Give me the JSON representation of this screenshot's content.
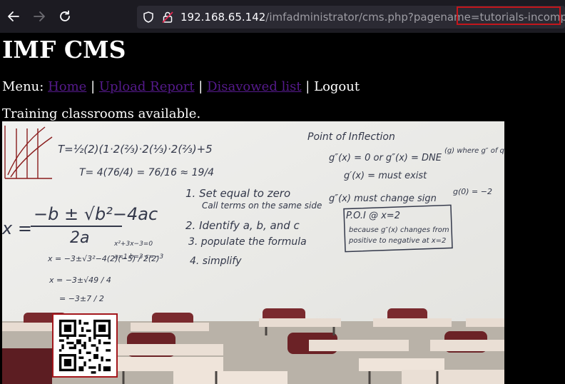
{
  "browser": {
    "url_host": "192.168.65.142",
    "url_path": "/imfadministrator/cms.php?pagename=",
    "url_query_highlight": "tutorials-incomplete"
  },
  "page": {
    "title": "IMF CMS",
    "menu_label": "Menu:",
    "menu_items": [
      {
        "label": "Home"
      },
      {
        "label": "Upload Report"
      },
      {
        "label": "Disavowed list"
      },
      {
        "label": "Logout"
      }
    ],
    "separator": "|",
    "intro": "Training classrooms available."
  },
  "whiteboard": {
    "formulas": {
      "t_eq_1": "T=½(2)(1·2(⅔)·2(⅓)·2(⅔)+5",
      "t_eq_2": "T= 4(76/4) = 76/16 ≈ 19/4",
      "quadratic_num": "−b ± √b²−4ac",
      "quadratic_den": "2a",
      "steps_1": "1. Set equal to zero",
      "steps_1b": "Call terms on the same side",
      "steps_2": "2. Identify a, b, and c",
      "steps_3": "3. populate the formula",
      "steps_4": "4. simplify",
      "poi_title": "Point of Inflection",
      "poi_1": "g″(x) = 0   or   g″(x) = DNE",
      "poi_2": "g′(x) = must exist",
      "poi_3": "g″(x) must change sign",
      "poi_box_1": "P.O.I @ x=2",
      "poi_box_2": "because g″(x) changes from",
      "poi_box_3": "positive to negative at x=2",
      "right_1": "(g) where g″ of ques",
      "right_2": "g(0) = −2",
      "x_eq_1": "x = −3±√3²−4(2)(−5) / 2(2)",
      "x_eq_2": "x = −3±√49 / 4",
      "x_eq_3": "= −3±7 / 2",
      "abc": "a=1 b=3 c=−3",
      "small_eq": "x²+3x−3=0"
    }
  },
  "colors": {
    "background": "#000000",
    "link_visited": "#551a8b",
    "highlight": "#c4161c"
  }
}
